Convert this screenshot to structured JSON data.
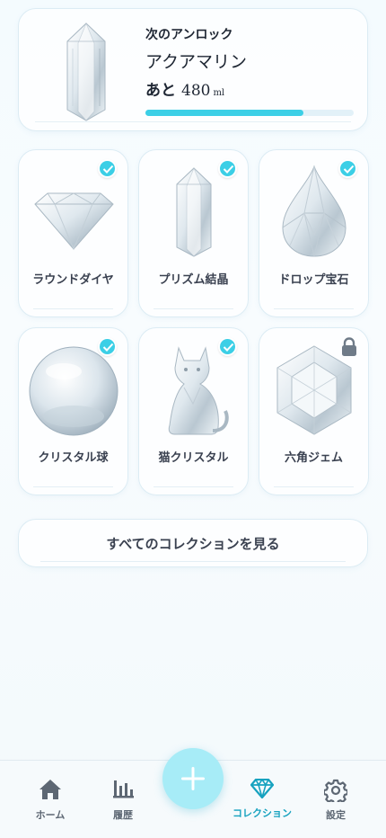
{
  "next_unlock": {
    "label": "次のアンロック",
    "name": "アクアマリン",
    "remaining_prefix": "あと",
    "remaining_value": "480",
    "remaining_unit": "ml",
    "progress": 0.76
  },
  "collection": [
    {
      "name": "ラウンドダイヤ",
      "unlocked": true,
      "icon": "round-diamond"
    },
    {
      "name": "プリズム結晶",
      "unlocked": true,
      "icon": "prism-crystal"
    },
    {
      "name": "ドロップ宝石",
      "unlocked": true,
      "icon": "drop-gem"
    },
    {
      "name": "クリスタル球",
      "unlocked": true,
      "icon": "crystal-ball"
    },
    {
      "name": "猫クリスタル",
      "unlocked": true,
      "icon": "cat-crystal"
    },
    {
      "name": "六角ジェム",
      "unlocked": false,
      "icon": "hexagon-gem"
    }
  ],
  "see_all_label": "すべてのコレクションを見る",
  "tabs": [
    {
      "label": "ホーム",
      "icon": "home-icon",
      "active": false
    },
    {
      "label": "履歴",
      "icon": "bar-chart-icon",
      "active": false
    },
    {
      "label": "コレクション",
      "icon": "diamond-icon",
      "active": true
    },
    {
      "label": "設定",
      "icon": "gear-icon",
      "active": false
    }
  ],
  "add_button_icon": "plus-icon",
  "colors": {
    "accent": "#3ccfe6",
    "active_tab": "#17a2bf",
    "fab": "#a7ecf7"
  }
}
